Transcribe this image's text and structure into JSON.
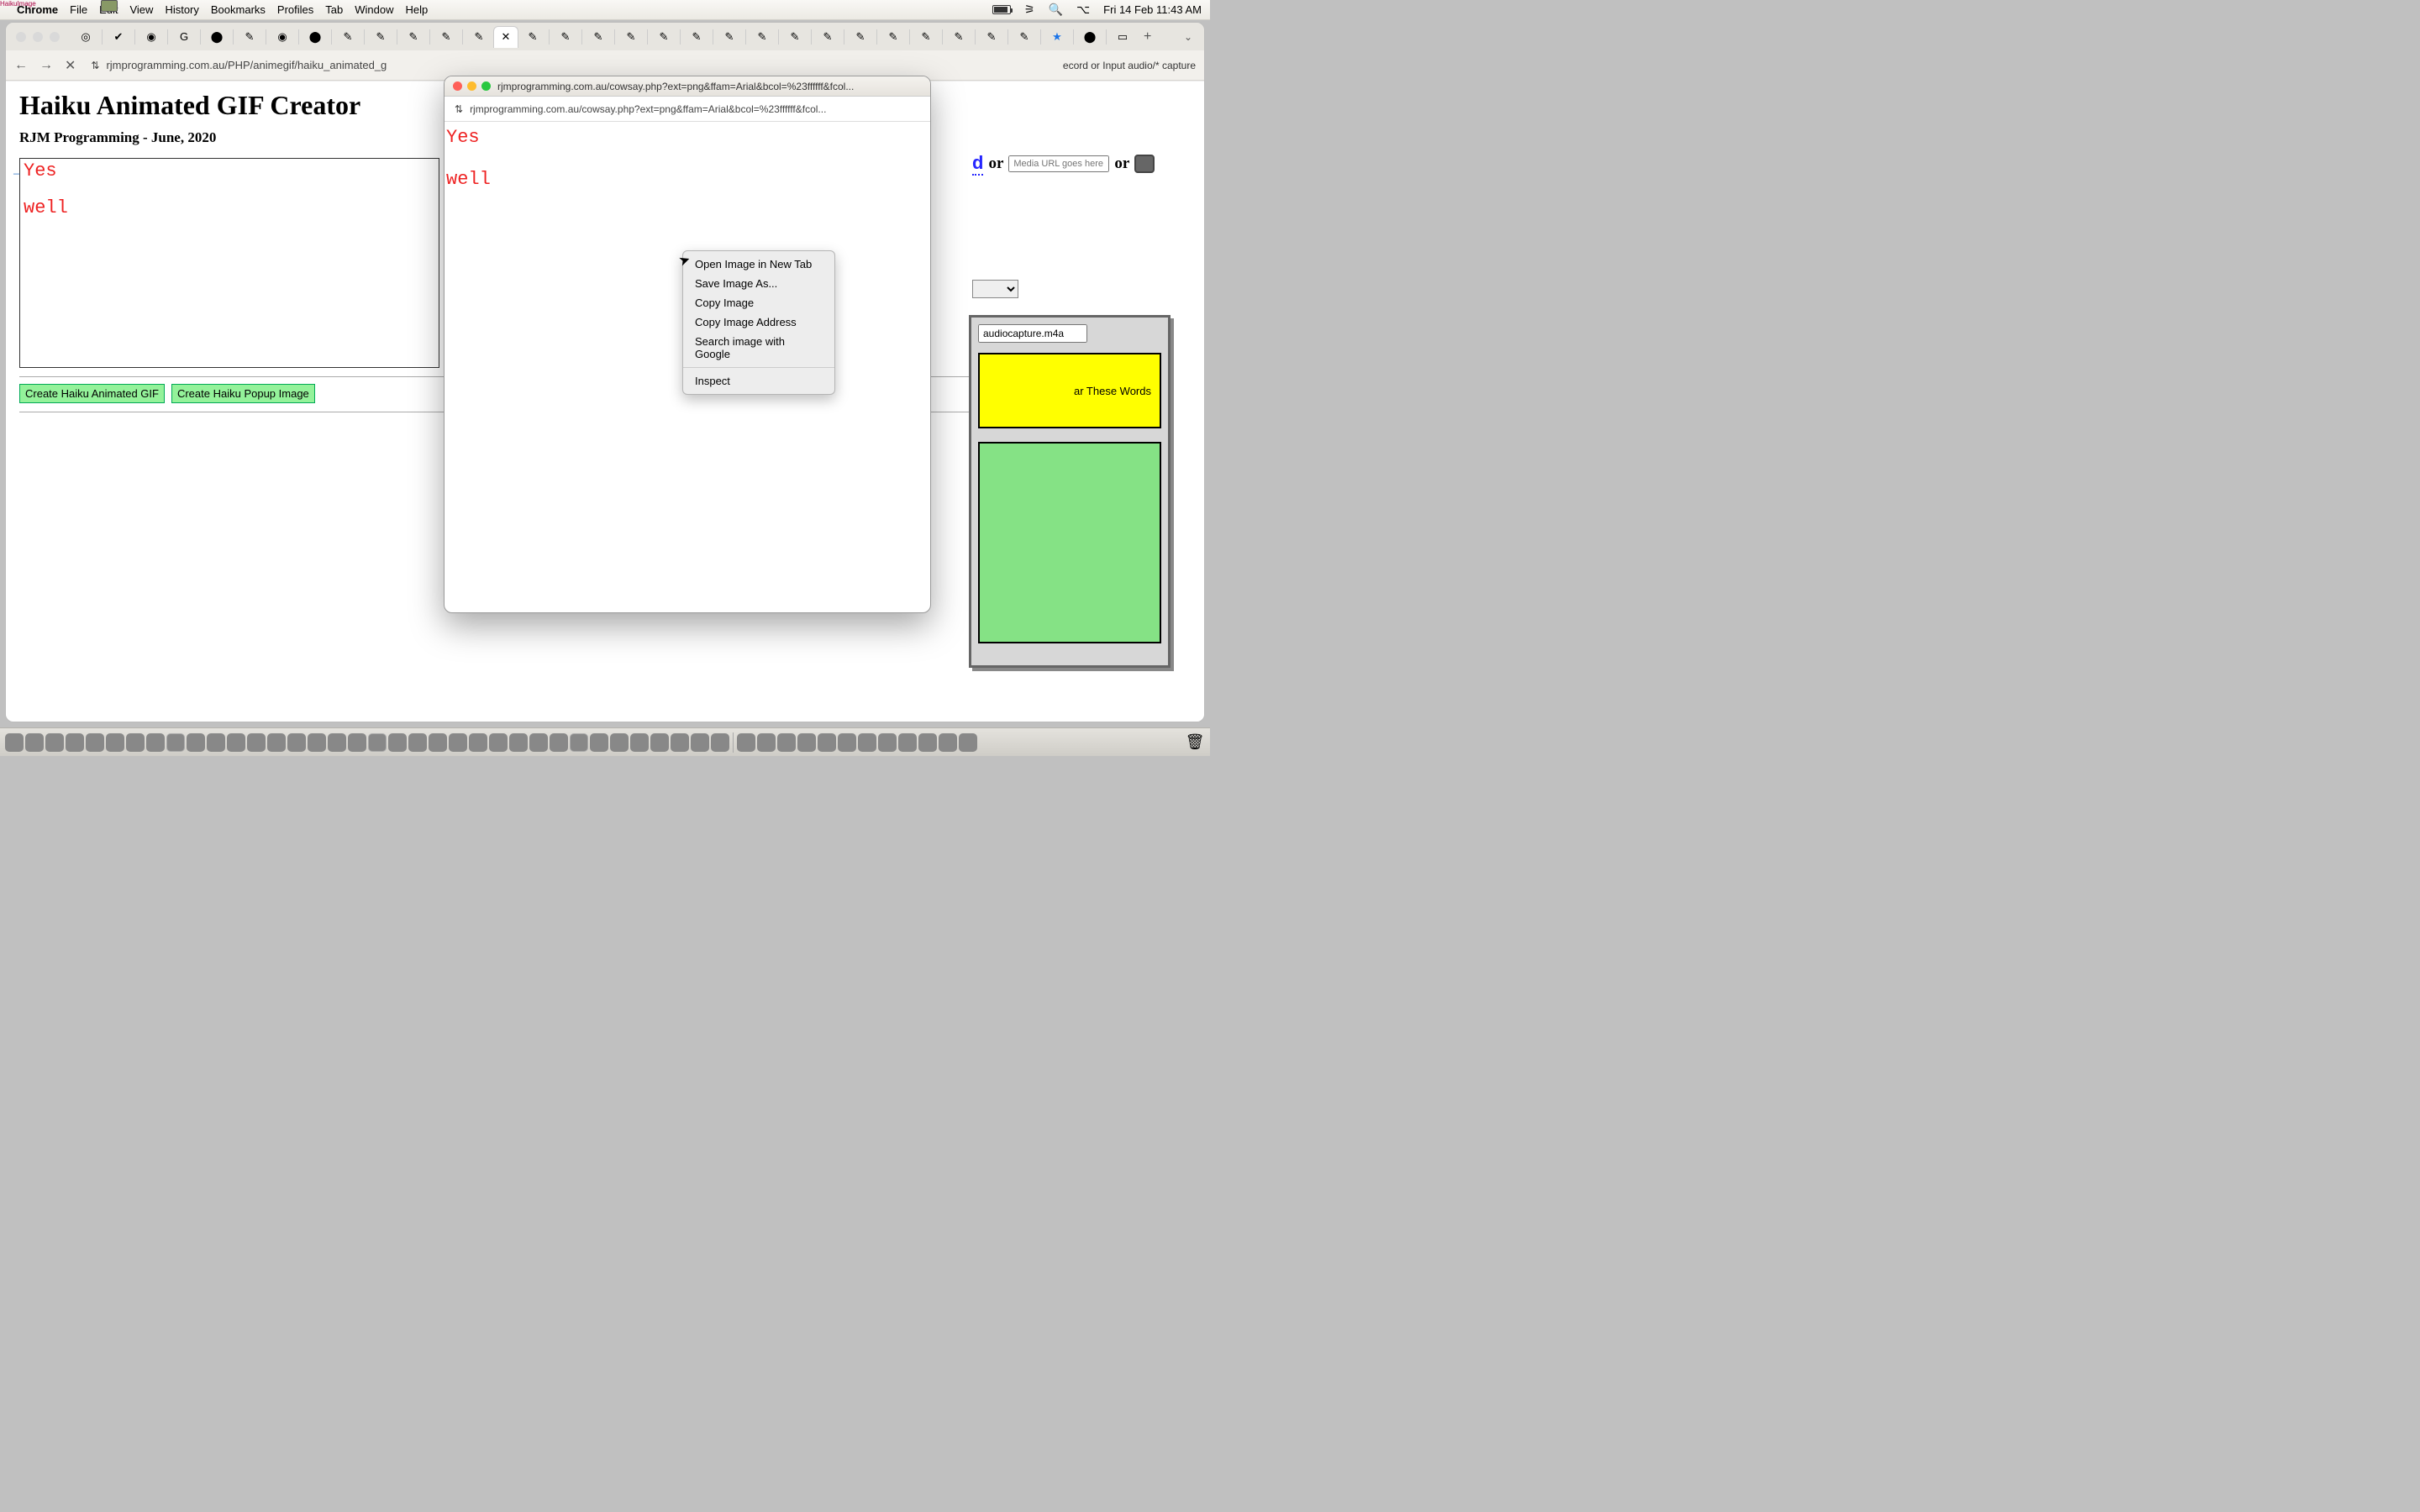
{
  "menubar": {
    "overlay_text": "HaikuImage",
    "apple": "",
    "app": "Chrome",
    "items": [
      "File",
      "Edit",
      "View",
      "History",
      "Bookmarks",
      "Profiles",
      "Tab",
      "Window",
      "Help"
    ],
    "clock": "Fri 14 Feb  11:43 AM"
  },
  "chrome": {
    "address": "rjmprogramming.com.au/PHP/animegif/haiku_animated_g",
    "title_peek": "ecord or Input audio/* capture"
  },
  "page": {
    "h1": "Haiku Animated GIF Creator",
    "h3": "RJM Programming - June, 2020",
    "haiku_line1": "Yes",
    "haiku_line2": "well",
    "btn_create_gif": "Create Haiku Animated GIF",
    "btn_create_popup": "Create Haiku Popup Image"
  },
  "rightpanel": {
    "d": "d",
    "or1": "or",
    "media_placeholder": "Media URL goes here ..",
    "or2": "or",
    "filename": "audiocapture.m4a",
    "yellow_text": "ar These Words"
  },
  "popup": {
    "title": "rjmprogramming.com.au/cowsay.php?ext=png&ffam=Arial&bcol=%23ffffff&fcol...",
    "addr": "rjmprogramming.com.au/cowsay.php?ext=png&ffam=Arial&bcol=%23ffffff&fcol...",
    "line1": "Yes",
    "line2": "well"
  },
  "contextmenu": {
    "items": [
      "Open Image in New Tab",
      "Save Image As...",
      "Copy Image",
      "Copy Image Address",
      "Search image with Google"
    ],
    "inspect": "Inspect"
  }
}
